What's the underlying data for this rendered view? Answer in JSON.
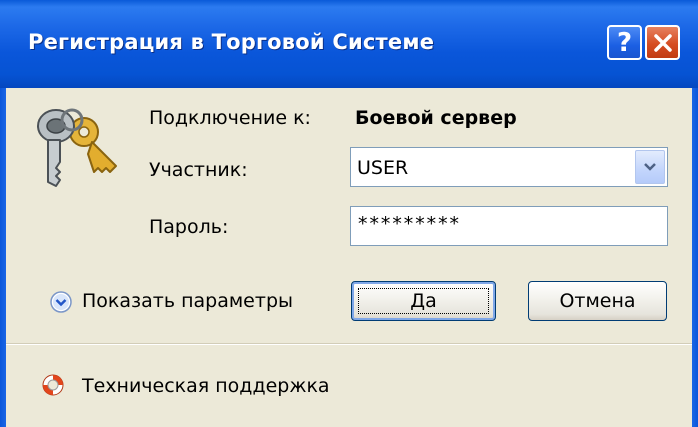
{
  "window": {
    "title": "Регистрация в Торговой Системе",
    "help_glyph": "?",
    "close_glyph": "×"
  },
  "connection": {
    "label": "Подключение к:",
    "value": "Боевой сервер"
  },
  "user": {
    "label": "Участник:",
    "value": "USER"
  },
  "password": {
    "label": "Пароль:",
    "value": "*********"
  },
  "options": {
    "toggle_label": "Показать параметры"
  },
  "buttons": {
    "ok": "Да",
    "cancel": "Отмена"
  },
  "footer": {
    "support_link": "Техническая поддержка"
  },
  "colors": {
    "titlebar": "#0a56da",
    "dialog_bg": "#ece9d8",
    "close_button": "#d64d22",
    "button_border": "#003c74"
  },
  "icons": [
    "keys-icon",
    "help-icon",
    "close-icon",
    "chevron-down-icon",
    "expand-circle-icon",
    "lifebuoy-icon"
  ]
}
